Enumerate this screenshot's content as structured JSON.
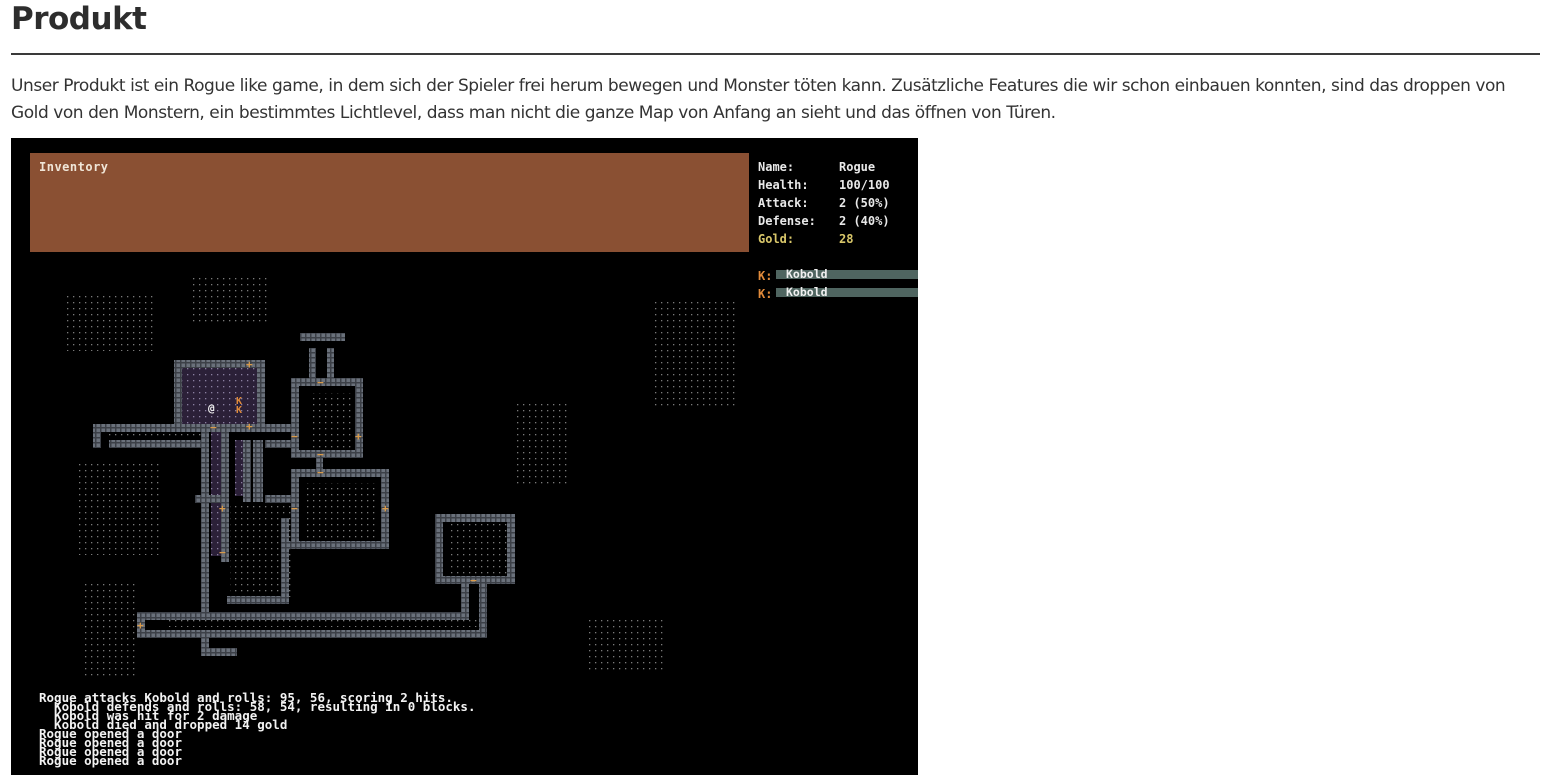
{
  "page": {
    "title": "Produkt",
    "description": "Unser Produkt ist ein Rogue like game, in dem sich der Spieler frei herum bewegen und Monster töten kann. Zusätzliche Features die wir schon einbauen konnten, sind das droppen von Gold von den Monstern, ein bestimmtes Lichtlevel, dass man nicht die ganze Map von Anfang an sieht und das öffnen von Türen."
  },
  "game": {
    "inventory": {
      "title": "Inventory"
    },
    "stats": [
      {
        "key": "Name:",
        "value": "Rogue"
      },
      {
        "key": "Health:",
        "value": "100/100"
      },
      {
        "key": "Attack:",
        "value": "2 (50%)"
      },
      {
        "key": "Defense:",
        "value": "2 (40%)"
      },
      {
        "key": "Gold:",
        "value": "28"
      }
    ],
    "enemies": [
      {
        "key": "K:",
        "name": "Kobold"
      },
      {
        "key": "K:",
        "name": "Kobold"
      }
    ],
    "map_glyphs": {
      "player": "@",
      "monster": "K"
    },
    "log": [
      "Rogue attacks Kobold and rolls: 95, 56, scoring 2 hits.",
      "  Kobold defends and rolls: 58, 54, resulting in 0 blocks.",
      "  Kobold was hit for 2 damage",
      "  Kobold died and dropped 14 gold",
      "Rogue opened a door",
      "Rogue opened a door",
      "Rogue opened a door",
      "Rogue opened a door"
    ],
    "colors": {
      "inventory_bg": "#8a5033",
      "wall": "#4a4f57",
      "lit_floor": "#2b2038",
      "gold_text": "#d9c76a",
      "monster": "#e08a3a",
      "enemy_bar": "#4f6560"
    }
  }
}
